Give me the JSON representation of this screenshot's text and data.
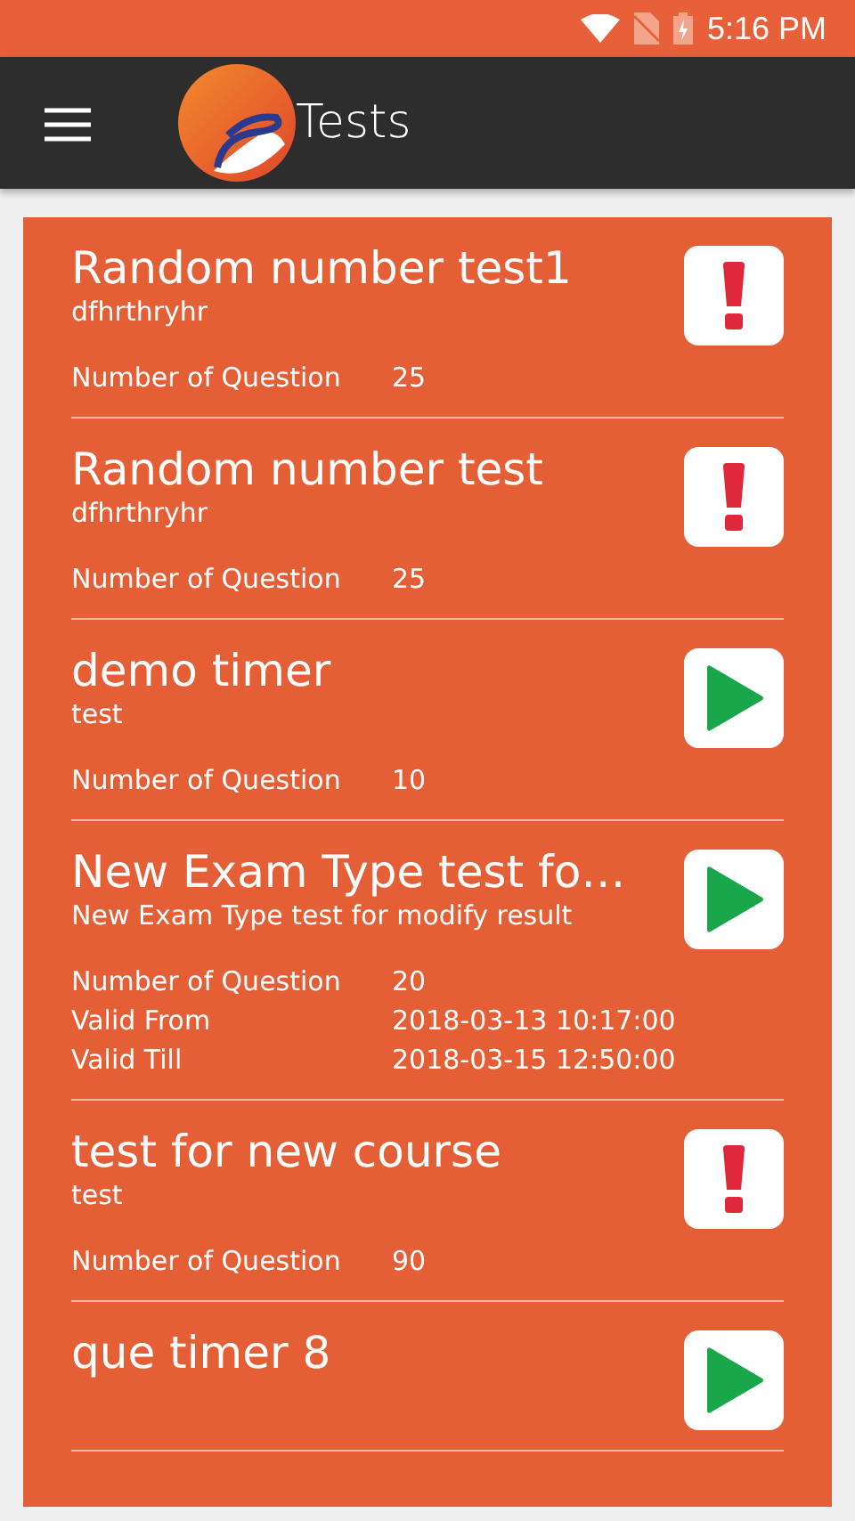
{
  "status_bar": {
    "time": "5:16 PM"
  },
  "app_bar": {
    "title": "Tests"
  },
  "tests": [
    {
      "title": "Random number test1",
      "subtitle": "dfhrthryhr",
      "kind": "alert",
      "details": [
        {
          "label": "Number of Question",
          "value": "25"
        }
      ]
    },
    {
      "title": "Random number test",
      "subtitle": "dfhrthryhr",
      "kind": "alert",
      "details": [
        {
          "label": "Number of Question",
          "value": "25"
        }
      ]
    },
    {
      "title": "demo timer",
      "subtitle": "test",
      "kind": "play",
      "details": [
        {
          "label": "Number of Question",
          "value": "10"
        }
      ]
    },
    {
      "title": "New Exam Type test fo…",
      "subtitle": "New Exam Type test for modify result",
      "kind": "play",
      "details": [
        {
          "label": "Number of Question",
          "value": "20"
        },
        {
          "label": "Valid From",
          "value": "2018-03-13 10:17:00"
        },
        {
          "label": "Valid Till",
          "value": "2018-03-15 12:50:00"
        }
      ]
    },
    {
      "title": "test for new course",
      "subtitle": "test",
      "kind": "alert",
      "details": [
        {
          "label": "Number of Question",
          "value": "90"
        }
      ]
    },
    {
      "title": "que timer 8",
      "kind": "play"
    }
  ]
}
